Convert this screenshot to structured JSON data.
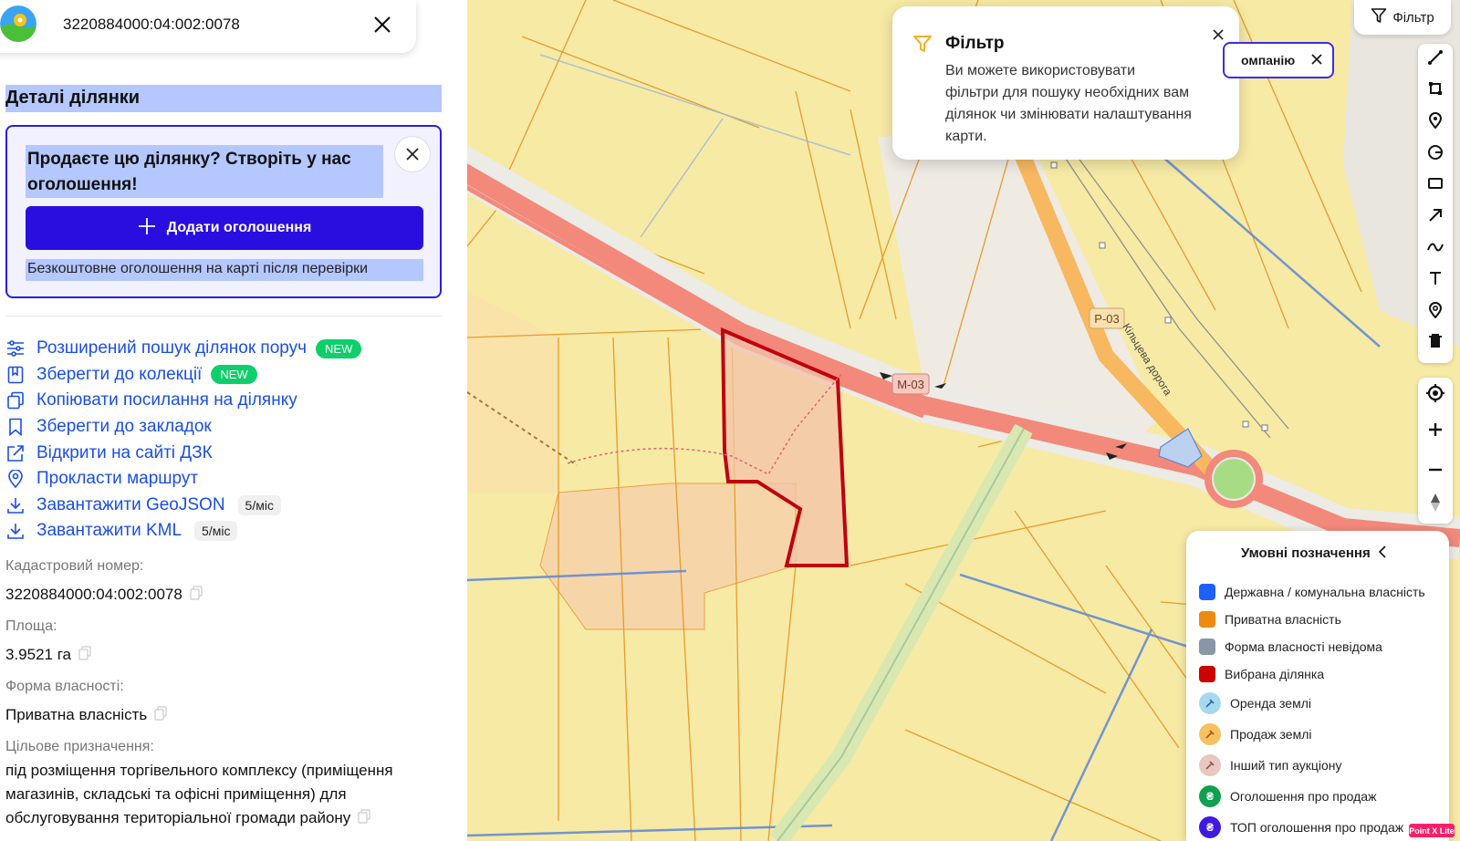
{
  "search": {
    "value": "3220884000:04:002:0078"
  },
  "section_title": "Деталі ділянки",
  "promo": {
    "heading": "Продаєте цю ділянку? Створіть у нас оголошення!",
    "button_label": "Додати оголошення",
    "note": "Безкоштовне оголошення на карті після перевірки"
  },
  "actions": [
    {
      "label": "Розширений пошук ділянок поруч",
      "badge": "NEW",
      "icon": "sliders-icon"
    },
    {
      "label": "Зберегти до колекції",
      "badge": "NEW",
      "icon": "collection-icon"
    },
    {
      "label": "Копіювати посилання на ділянку",
      "icon": "copy-link-icon"
    },
    {
      "label": "Зберегти до закладок",
      "icon": "bookmark-icon"
    },
    {
      "label": "Відкрити на сайті ДЗК",
      "icon": "external-link-icon"
    },
    {
      "label": "Прокласти маршрут",
      "icon": "route-pin-icon"
    },
    {
      "label": "Завантажити GeoJSON",
      "limit": "5/міс",
      "icon": "download-icon"
    },
    {
      "label": "Завантажити KML",
      "limit": "5/міс",
      "icon": "download-icon"
    }
  ],
  "fields": {
    "cadastral_label": "Кадастровий номер:",
    "cadastral_value": "3220884000:04:002:0078",
    "area_label": "Площа:",
    "area_value": "3.9521 га",
    "ownership_label": "Форма власності:",
    "ownership_value": "Приватна власність",
    "purpose_label": "Цільове призначення:",
    "purpose_value": "під розміщення торгівельного комплексу (приміщення магазинів, складські та офісні приміщення) для обслуговування територіальної громади району"
  },
  "map": {
    "road_labels": {
      "m03": "М-03",
      "p03": "Р-03",
      "ring": "Кільцева дорога"
    },
    "filter_button_label": "Фільтр",
    "company_chip_label": "омпанію",
    "filter_popup": {
      "title": "Фільтр",
      "text": "Ви можете використовувати фільтри для пошуку необхідних вам ділянок чи змінювати налаштування карти."
    },
    "legend": {
      "title": "Умовні позначення",
      "items": [
        {
          "label": "Державна / комунальна власність",
          "color": "#1f5fff",
          "kind": "square"
        },
        {
          "label": "Приватна власність",
          "color": "#ee8a10",
          "kind": "square"
        },
        {
          "label": "Форма власності невідома",
          "color": "#8896a8",
          "kind": "square"
        },
        {
          "label": "Вибрана ділянка",
          "color": "#cc0000",
          "kind": "square"
        },
        {
          "label": "Оренда землі",
          "color": "#a8d8f0",
          "kind": "circle"
        },
        {
          "label": "Продаж землі",
          "color": "#f8c060",
          "kind": "circle"
        },
        {
          "label": "Інший тип аукціону",
          "color": "#e8c8c0",
          "kind": "circle"
        },
        {
          "label": "Оголошення про продаж",
          "color": "#10a050",
          "kind": "circle",
          "glyph": "₴"
        },
        {
          "label": "ТОП оголошення про продаж",
          "color": "#4018e0",
          "kind": "circle",
          "glyph": "₴"
        }
      ]
    },
    "corner_badge": "Point X Lite"
  },
  "colors": {
    "accent": "#2a0ee0",
    "link": "#1a4ee8",
    "new_badge": "#0fcf6a",
    "highlight": "#b4c8ff"
  }
}
